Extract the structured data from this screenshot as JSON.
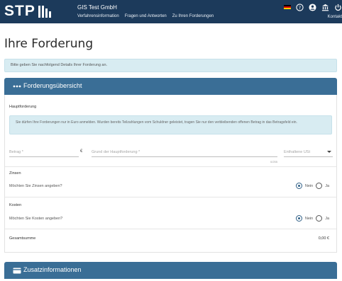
{
  "header": {
    "logo_text": "STP",
    "company": "GIS Test GmbH",
    "nav": [
      "Verfahrensinformation",
      "Fragen und Antworten",
      "Zu Ihren Forderungen"
    ],
    "contact": "Kontakt",
    "icons": [
      "german-flag-icon",
      "help-icon",
      "user-icon",
      "bank-icon",
      "power-icon"
    ]
  },
  "page": {
    "title": "Ihre Forderung",
    "info": "Bitte geben Sie nachfolgend Details Ihrer Forderung an."
  },
  "overview": {
    "heading": "Forderungsübersicht",
    "main_claim": {
      "title": "Hauptforderung",
      "hint": "Sie dürfen Ihre Forderungen nur in Euro anmelden. Wurden bereits Teilzahlungen vom Schuldner geleistet, tragen Sie nur den verbleibenden offenen Betrag in das Betragsfeld ein.",
      "amount_placeholder": "Betrag *",
      "currency": "€",
      "reason_placeholder": "Grund der Hauptforderung *",
      "char_counter": "0/255",
      "vat_placeholder": "Enthaltene USt"
    },
    "interest": {
      "title": "Zinsen",
      "question": "Möchten Sie Zinsen angeben?",
      "options": [
        "Nein",
        "Ja"
      ],
      "selected": "Nein"
    },
    "costs": {
      "title": "Kosten",
      "question": "Möchten Sie Kosten angeben?",
      "options": [
        "Nein",
        "Ja"
      ],
      "selected": "Nein"
    },
    "total": {
      "label": "Gesamtsumme",
      "value": "0,00 €"
    }
  },
  "additional": {
    "heading": "Zusatzinformationen"
  },
  "colors": {
    "topbar": "#1c3a5b",
    "panel_header": "#3a6e96",
    "info_bg": "#d8ecf2"
  }
}
